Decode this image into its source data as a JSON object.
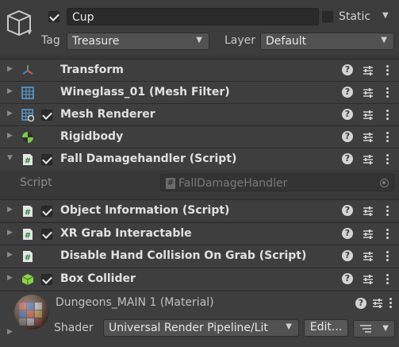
{
  "header": {
    "object_name": "Cup",
    "active": true,
    "static_label": "Static",
    "static_checked": false,
    "tag_label": "Tag",
    "tag_value": "Treasure",
    "layer_label": "Layer",
    "layer_value": "Default"
  },
  "components": [
    {
      "title": "Transform",
      "icon": "transform-icon",
      "has_checkbox": false,
      "expanded": false
    },
    {
      "title": "Wineglass_01 (Mesh Filter)",
      "icon": "mesh-filter-icon",
      "has_checkbox": false,
      "expanded": false
    },
    {
      "title": "Mesh Renderer",
      "icon": "mesh-renderer-icon",
      "has_checkbox": true,
      "checked": true,
      "expanded": false
    },
    {
      "title": "Rigidbody",
      "icon": "rigidbody-icon",
      "has_checkbox": false,
      "expanded": false
    },
    {
      "title": "Fall Damagehandler (Script)",
      "icon": "script-icon",
      "has_checkbox": true,
      "checked": true,
      "expanded": true
    },
    {
      "title": "Object Information (Script)",
      "icon": "script-icon",
      "has_checkbox": true,
      "checked": true,
      "expanded": false
    },
    {
      "title": "XR Grab Interactable",
      "icon": "script-icon",
      "has_checkbox": true,
      "checked": true,
      "expanded": false
    },
    {
      "title": "Disable Hand Collision On Grab (Script)",
      "icon": "script-icon",
      "has_checkbox": false,
      "expanded": false
    },
    {
      "title": "Box Collider",
      "icon": "box-collider-icon",
      "has_checkbox": true,
      "checked": true,
      "expanded": false
    }
  ],
  "script_field": {
    "label": "Script",
    "value": "FallDamageHandler"
  },
  "material": {
    "title": "Dungeons_MAIN 1 (Material)",
    "shader_label": "Shader",
    "shader_value": "Universal Render Pipeline/Lit",
    "edit_label": "Edit..."
  },
  "colors": {
    "background": "#383838",
    "row": "#3e3e3e",
    "field": "#2a2a2a",
    "dropdown": "#515151"
  }
}
